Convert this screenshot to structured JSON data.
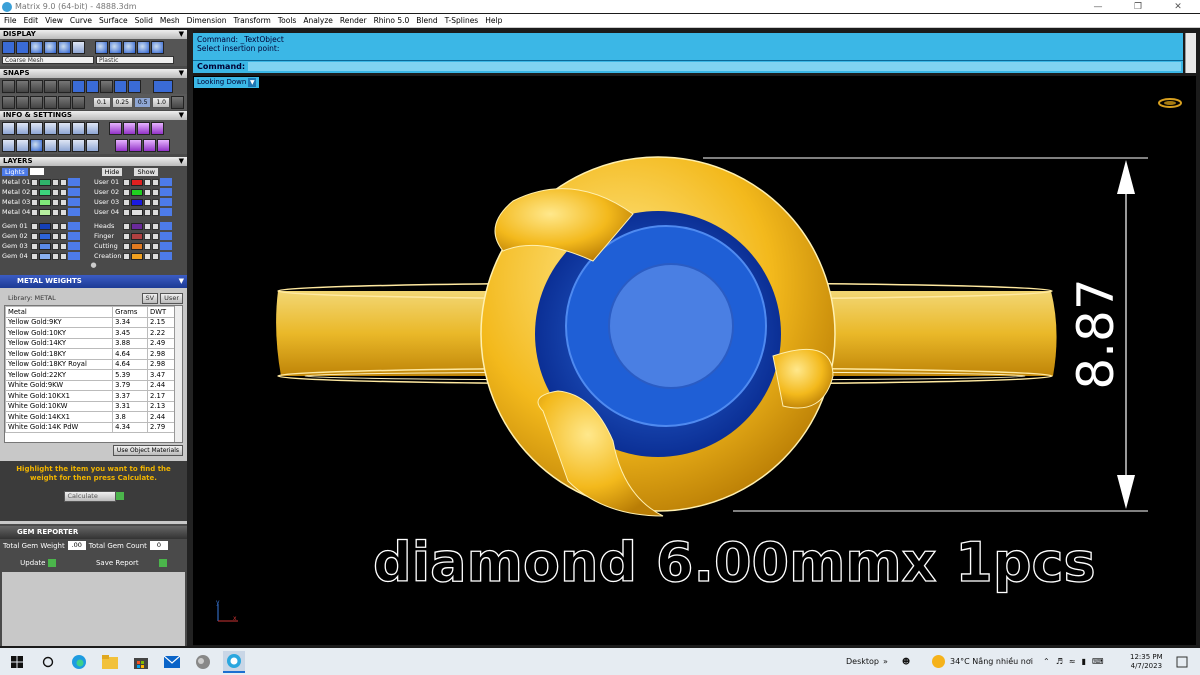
{
  "title_bar": {
    "title": "Matrix 9.0 (64-bit) - 4888.3dm"
  },
  "menu": [
    "File",
    "Edit",
    "View",
    "Curve",
    "Surface",
    "Solid",
    "Mesh",
    "Dimension",
    "Transform",
    "Tools",
    "Analyze",
    "Render",
    "Rhino 5.0",
    "Blend",
    "T-Splines",
    "Help"
  ],
  "display": {
    "header": "DISPLAY",
    "mesh_select": "Coarse Mesh",
    "material_select": "Plastic"
  },
  "snaps": {
    "header": "SNAPS",
    "values": [
      "0.1",
      "0.25",
      "0.5",
      "1.0"
    ]
  },
  "info": {
    "header": "INFO & SETTINGS"
  },
  "layers": {
    "header": "LAYERS",
    "lights_label": "Lights",
    "hide_label": "Hide",
    "show_label": "Show",
    "left": [
      {
        "name": "Metal 01",
        "color": "#2fb36a"
      },
      {
        "name": "Metal 02",
        "color": "#3cd27c"
      },
      {
        "name": "Metal 03",
        "color": "#7fe87a"
      },
      {
        "name": "Metal 04",
        "color": "#b8f0a0"
      },
      {
        "name": "Gem 01",
        "color": "#1540b8"
      },
      {
        "name": "Gem 02",
        "color": "#2e64d8"
      },
      {
        "name": "Gem 03",
        "color": "#5a8ae8"
      },
      {
        "name": "Gem 04",
        "color": "#8ab0f0"
      }
    ],
    "right": [
      {
        "name": "User 01",
        "color": "#e02020"
      },
      {
        "name": "User 02",
        "color": "#20d020"
      },
      {
        "name": "User 03",
        "color": "#1a1ae0"
      },
      {
        "name": "User 04",
        "color": "#e0e0e0"
      },
      {
        "name": "Heads",
        "color": "#6a2a9a"
      },
      {
        "name": "Finger",
        "color": "#b04040"
      },
      {
        "name": "Cutting",
        "color": "#e07a20"
      },
      {
        "name": "Creation",
        "color": "#f0a020"
      }
    ]
  },
  "metal_weights": {
    "header": "METAL WEIGHTS",
    "library_label": "Library: METAL",
    "sv_label": "SV",
    "user_label": "User",
    "columns": [
      "Metal",
      "Grams",
      "DWT"
    ],
    "rows": [
      [
        "Yellow Gold:9KY",
        "3.34",
        "2.15"
      ],
      [
        "Yellow Gold:10KY",
        "3.45",
        "2.22"
      ],
      [
        "Yellow Gold:14KY",
        "3.88",
        "2.49"
      ],
      [
        "Yellow Gold:18KY",
        "4.64",
        "2.98"
      ],
      [
        "Yellow Gold:18KY Royal",
        "4.64",
        "2.98"
      ],
      [
        "Yellow Gold:22KY",
        "5.39",
        "3.47"
      ],
      [
        "White Gold:9KW",
        "3.79",
        "2.44"
      ],
      [
        "White Gold:10KX1",
        "3.37",
        "2.17"
      ],
      [
        "White Gold:10KW",
        "3.31",
        "2.13"
      ],
      [
        "White Gold:14KX1",
        "3.8",
        "2.44"
      ],
      [
        "White Gold:14K PdW",
        "4.34",
        "2.79"
      ]
    ],
    "use_object_materials": "Use Object Materials",
    "hint": "Highlight the item you want to find the weight for then press Calculate.",
    "calculate_label": "Calculate"
  },
  "gem_reporter": {
    "header": "GEM REPORTER",
    "total_weight_label": "Total Gem Weight",
    "total_weight_value": ".00",
    "total_count_label": "Total Gem Count",
    "total_count_value": "0",
    "update_label": "Update",
    "save_report_label": "Save Report"
  },
  "command": {
    "line1": "Command: _TextObject",
    "line2": "Select insertion point:",
    "prompt_label": "Command:",
    "input_value": ""
  },
  "viewport": {
    "view_label": "Looking Down",
    "dimension_text": "8.87",
    "annotation": "diamond 6.00mmx 1pcs",
    "axis_y": "y",
    "axis_x": "x"
  },
  "taskbar": {
    "desktop_label": "Desktop",
    "weather": "34°C  Nắng nhiều nơi",
    "time": "12:35 PM",
    "date": "4/7/2023"
  }
}
